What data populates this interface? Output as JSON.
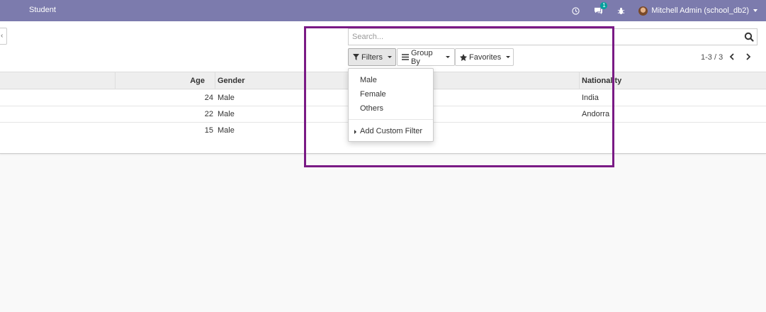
{
  "navbar": {
    "app_title": "Student",
    "chat_badge": "1",
    "user_name": "Mitchell Admin (school_db2)"
  },
  "search": {
    "placeholder": "Search..."
  },
  "toolbar": {
    "filters_label": "Filters",
    "groupby_label": "Group By",
    "favorites_label": "Favorites"
  },
  "pager": {
    "text": "1-3 / 3"
  },
  "table": {
    "headers": {
      "age": "Age",
      "gender": "Gender",
      "nationality": "Nationality"
    },
    "rows": [
      {
        "age": "24",
        "gender": "Male",
        "nationality": "India"
      },
      {
        "age": "22",
        "gender": "Male",
        "nationality": "Andorra"
      },
      {
        "age": "15",
        "gender": "Male",
        "nationality": ""
      }
    ]
  },
  "filters_menu": {
    "items": [
      "Male",
      "Female",
      "Others"
    ],
    "custom": "Add Custom Filter"
  },
  "colors": {
    "navbar": "#7c7bad",
    "highlight": "#7a1a85"
  }
}
